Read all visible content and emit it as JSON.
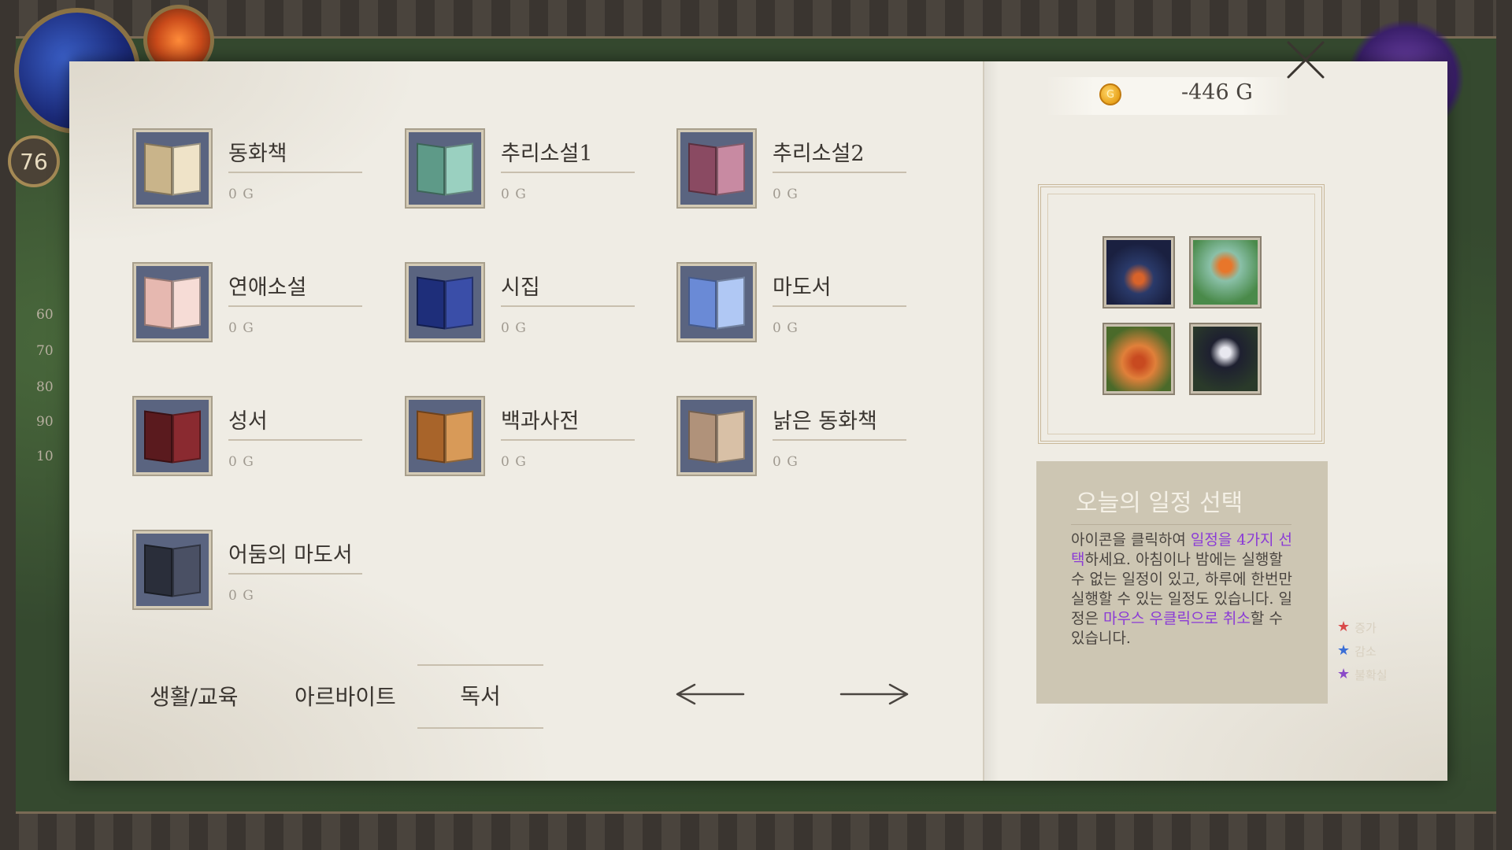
{
  "hud": {
    "level": "76",
    "scale": [
      "60",
      "70",
      "80",
      "90",
      "10"
    ]
  },
  "legend": [
    {
      "label": "증가",
      "color": "#d94a4a"
    },
    {
      "label": "감소",
      "color": "#3a6ed6"
    },
    {
      "label": "불확실",
      "color": "#8a4ac8"
    }
  ],
  "books": [
    {
      "name": "동화책",
      "price": "0 G",
      "colors": [
        "#c9b48a",
        "#efe3c8"
      ]
    },
    {
      "name": "추리소설1",
      "price": "0 G",
      "colors": [
        "#5e9a88",
        "#9ad0c0"
      ]
    },
    {
      "name": "추리소설2",
      "price": "0 G",
      "colors": [
        "#8a4a62",
        "#c88aa2"
      ]
    },
    {
      "name": "연애소설",
      "price": "0 G",
      "colors": [
        "#e6b8b0",
        "#f6dcd6"
      ]
    },
    {
      "name": "시집",
      "price": "0 G",
      "colors": [
        "#1e2e7a",
        "#3a4ea8"
      ]
    },
    {
      "name": "마도서",
      "price": "0 G",
      "colors": [
        "#6a8ad6",
        "#b0c8f4"
      ]
    },
    {
      "name": "성서",
      "price": "0 G",
      "colors": [
        "#5a1a1e",
        "#8a2a30"
      ]
    },
    {
      "name": "백과사전",
      "price": "0 G",
      "colors": [
        "#a8642a",
        "#d89a58"
      ]
    },
    {
      "name": "낡은 동화책",
      "price": "0 G",
      "colors": [
        "#b0927a",
        "#d8c0a6"
      ]
    },
    {
      "name": "어둠의 마도서",
      "price": "0 G",
      "colors": [
        "#2a2e3a",
        "#4a5064"
      ]
    }
  ],
  "tabs": [
    "생활/교육",
    "아르바이트",
    "독서"
  ],
  "gold": {
    "icon": "G",
    "value": "-446 G"
  },
  "schedule_slots": [
    "afternoon-icon",
    "morning-sun-icon",
    "evening-icon",
    "night-moon-icon"
  ],
  "info": {
    "title": "오늘의 일정 선택",
    "p1": "아이콘을 클릭하여 ",
    "h1": "일정을 4가지 선택",
    "p2": "하세요. 아침이나 밤에는 실행할 수 없는 일정이 있고, 하루에 한번만 실행할 수 있는 일정도 있습니다. 일정은 ",
    "h2": "마우스 우클릭으로 취소",
    "p3": "할 수 있습니다."
  }
}
